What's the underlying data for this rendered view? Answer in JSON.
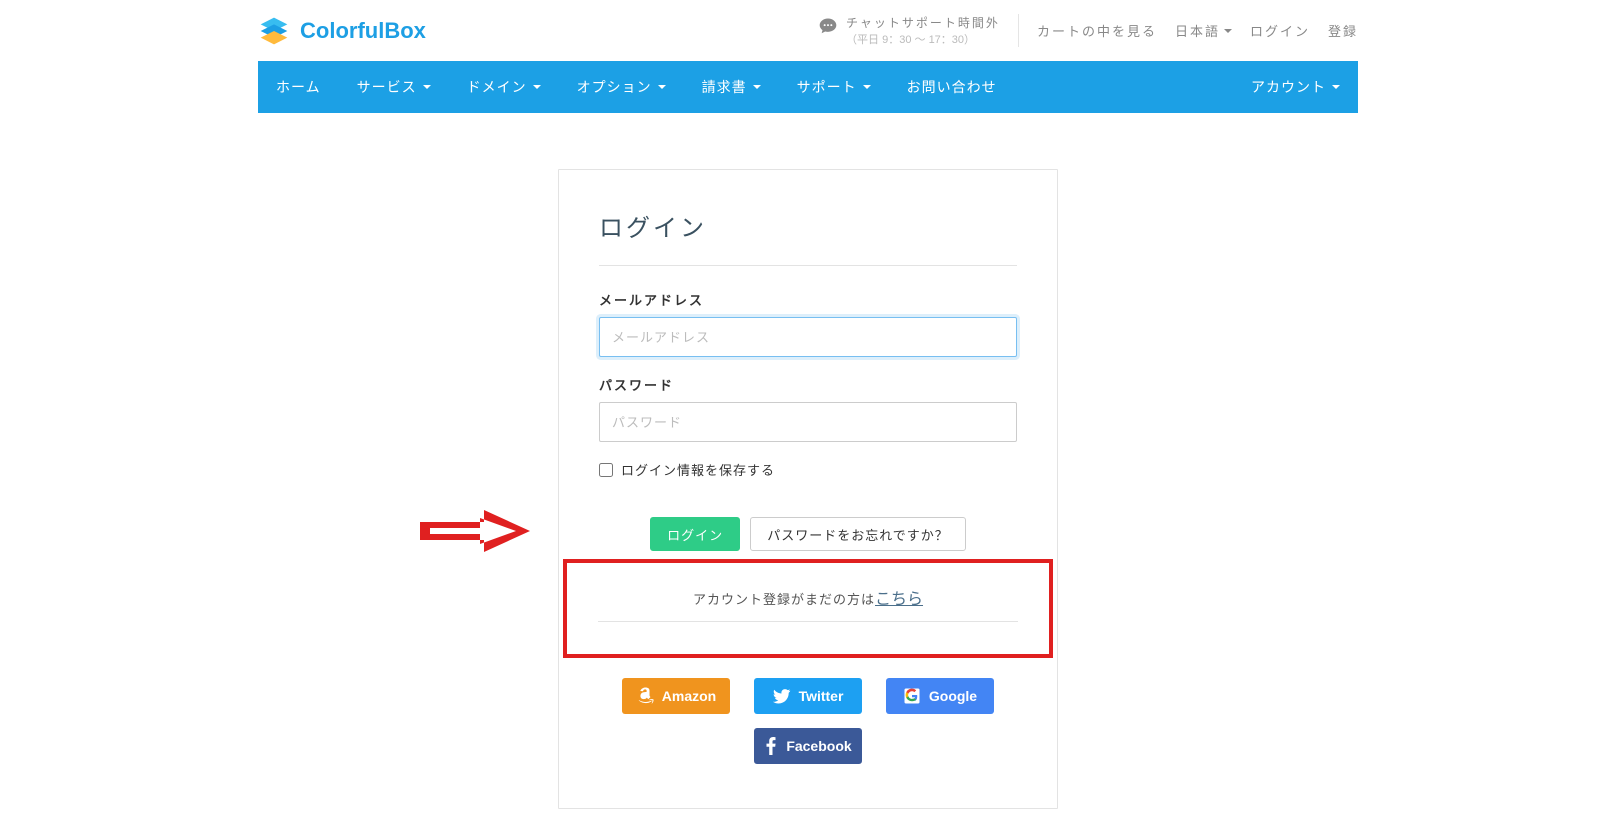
{
  "brand": {
    "name": "ColorfulBox"
  },
  "header": {
    "chat_title": "チャットサポート時間外",
    "chat_sub": "（平日 9：30 ～ 17：30）",
    "links": {
      "cart": "カートの中を見る",
      "language": "日本語",
      "login": "ログイン",
      "register": "登録"
    }
  },
  "nav": {
    "items": [
      "ホーム",
      "サービス",
      "ドメイン",
      "オプション",
      "請求書",
      "サポート",
      "お問い合わせ"
    ],
    "has_caret": [
      false,
      true,
      true,
      true,
      true,
      true,
      false
    ],
    "account": "アカウント"
  },
  "login": {
    "title": "ログイン",
    "email_label": "メールアドレス",
    "email_placeholder": "メールアドレス",
    "password_label": "パスワード",
    "password_placeholder": "パスワード",
    "remember_label": "ログイン情報を保存する",
    "submit_label": "ログイン",
    "forgot_label": "パスワードをお忘れですか？",
    "register_prompt_pre": "アカウント登録がまだの方は",
    "register_prompt_link": "こちら",
    "social": {
      "amazon": "Amazon",
      "twitter": "Twitter",
      "google": "Google",
      "facebook": "Facebook"
    }
  },
  "colors": {
    "brand_blue": "#1ca0e5",
    "annotation_red": "#e02020",
    "success_green": "#2ecc87"
  }
}
